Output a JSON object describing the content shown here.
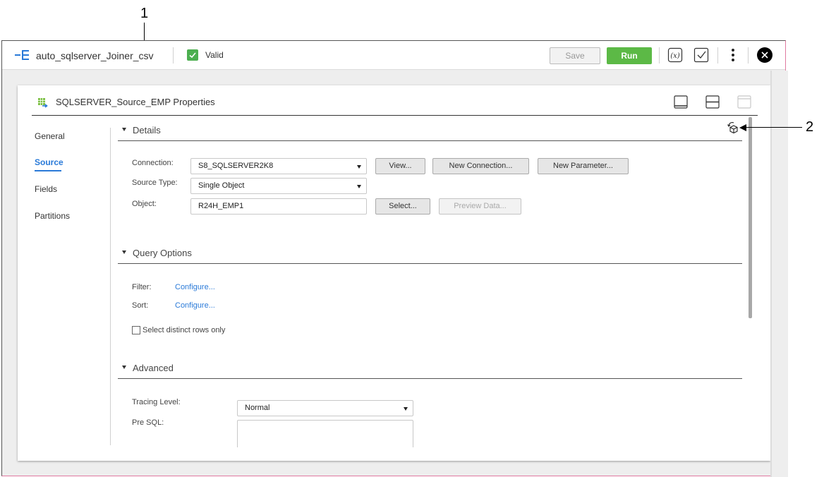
{
  "callouts": [
    {
      "number": "1",
      "target": "details-section-header"
    },
    {
      "number": "2",
      "target": "reset-properties-icon"
    }
  ],
  "topbar": {
    "app_icon": "mapping-icon",
    "title": "auto_sqlserver_Joiner_csv",
    "status_icon": "check-icon",
    "status_label": "Valid",
    "save_label": "Save",
    "run_label": "Run",
    "icons": [
      "parameters-icon",
      "validate-icon",
      "more-icon",
      "close-icon"
    ],
    "colors": {
      "run": "#5cb946",
      "valid": "#4caf50"
    }
  },
  "panel": {
    "icon": "source-table-icon",
    "title": "SQLSERVER_Source_EMP Properties",
    "layout_icons": [
      "dock-bottom-icon",
      "split-horizontal-icon",
      "dock-top-icon"
    ],
    "nav": [
      {
        "label": "General",
        "active": false
      },
      {
        "label": "Source",
        "active": true
      },
      {
        "label": "Fields",
        "active": false
      },
      {
        "label": "Partitions",
        "active": false
      }
    ],
    "accent_color": "#2a7ad8"
  },
  "details": {
    "title": "Details",
    "reset_icon": "reset-icon",
    "connection_label": "Connection:",
    "connection_value": "S8_SQLSERVER2K8",
    "view_label": "View...",
    "new_connection_label": "New Connection...",
    "new_parameter_label": "New Parameter...",
    "source_type_label": "Source Type:",
    "source_type_value": "Single Object",
    "object_label": "Object:",
    "object_value": "R24H_EMP1",
    "select_label": "Select...",
    "preview_label": "Preview Data..."
  },
  "query_options": {
    "title": "Query Options",
    "filter_label": "Filter:",
    "filter_link": "Configure...",
    "sort_label": "Sort:",
    "sort_link": "Configure...",
    "distinct_label": "Select distinct rows only",
    "distinct_checked": false
  },
  "advanced": {
    "title": "Advanced",
    "tracing_label": "Tracing Level:",
    "tracing_value": "Normal",
    "pre_sql_label": "Pre SQL:",
    "pre_sql_value": ""
  }
}
